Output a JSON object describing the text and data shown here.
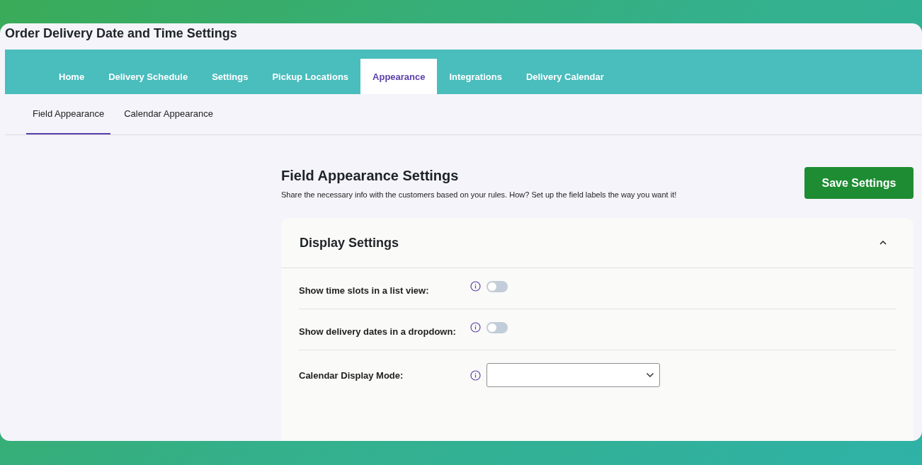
{
  "window": {
    "title": "Order Delivery Date and Time Settings"
  },
  "tabs": [
    {
      "label": "Home",
      "selected": false
    },
    {
      "label": "Delivery Schedule",
      "selected": false
    },
    {
      "label": "Settings",
      "selected": false
    },
    {
      "label": "Pickup Locations",
      "selected": false
    },
    {
      "label": "Appearance",
      "selected": true
    },
    {
      "label": "Integrations",
      "selected": false
    },
    {
      "label": "Delivery Calendar",
      "selected": false
    }
  ],
  "subtabs": [
    {
      "label": "Field Appearance",
      "selected": true
    },
    {
      "label": "Calendar Appearance",
      "selected": false
    }
  ],
  "header": {
    "title": "Field Appearance Settings",
    "description": "Share the necessary info with the customers based on your rules. How? Set up the field labels the way you want it!",
    "save_button": "Save Settings"
  },
  "section": {
    "title": "Display Settings",
    "expanded": true,
    "rows": [
      {
        "kind": "toggle",
        "label": "Show time slots in a list view:",
        "on": false
      },
      {
        "kind": "toggle",
        "label": "Show delivery dates in a dropdown:",
        "on": false
      },
      {
        "kind": "select",
        "label": "Calendar Display Mode:"
      }
    ]
  }
}
